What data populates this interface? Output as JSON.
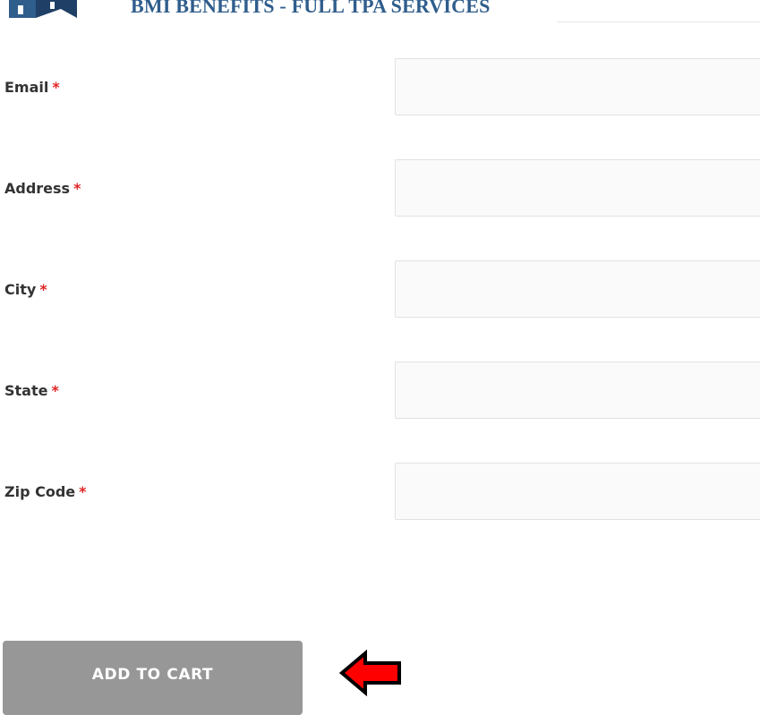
{
  "header": {
    "brand_title": "BMI BENEFITS - FULL TPA SERVICES",
    "logo_icon": "bmi-logo-icon"
  },
  "form": {
    "fields": [
      {
        "label": "Email",
        "required_mark": "*",
        "value": "",
        "placeholder": ""
      },
      {
        "label": "Address",
        "required_mark": "*",
        "value": "",
        "placeholder": ""
      },
      {
        "label": "City",
        "required_mark": "*",
        "value": "",
        "placeholder": ""
      },
      {
        "label": "State",
        "required_mark": "*",
        "value": "",
        "placeholder": ""
      },
      {
        "label": "Zip Code",
        "required_mark": "*",
        "value": "",
        "placeholder": ""
      }
    ],
    "submit_label": "ADD TO CART"
  },
  "annotation": {
    "icon": "left-arrow-icon",
    "color": "#ff0000"
  },
  "colors": {
    "brand": "#2f5d8c",
    "required": "#e02424",
    "button_bg": "#979797",
    "input_bg": "#fafafa"
  }
}
